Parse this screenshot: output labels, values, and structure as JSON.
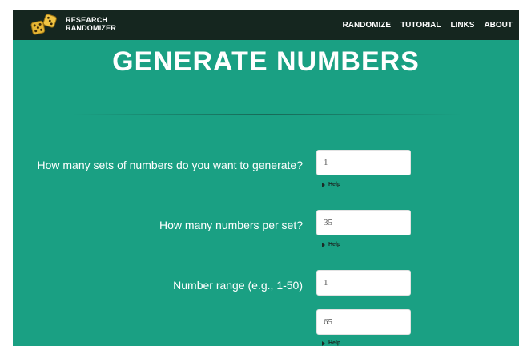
{
  "brand": {
    "line1": "RESEARCH",
    "line2": "RANDOMIZER"
  },
  "nav": {
    "items": [
      "RANDOMIZE",
      "TUTORIAL",
      "LINKS",
      "ABOUT"
    ]
  },
  "page": {
    "title": "GENERATE NUMBERS"
  },
  "form": {
    "sets_label": "How many sets of numbers do you want to generate?",
    "sets_value": "1",
    "per_set_label": "How many numbers per set?",
    "per_set_value": "35",
    "range_label": "Number range (e.g., 1-50)",
    "range_from_value": "1",
    "range_to_value": "65",
    "help_label": "Help"
  },
  "colors": {
    "background": "#1aa083",
    "topbar": "#15261f",
    "dice": "#e6b634"
  }
}
